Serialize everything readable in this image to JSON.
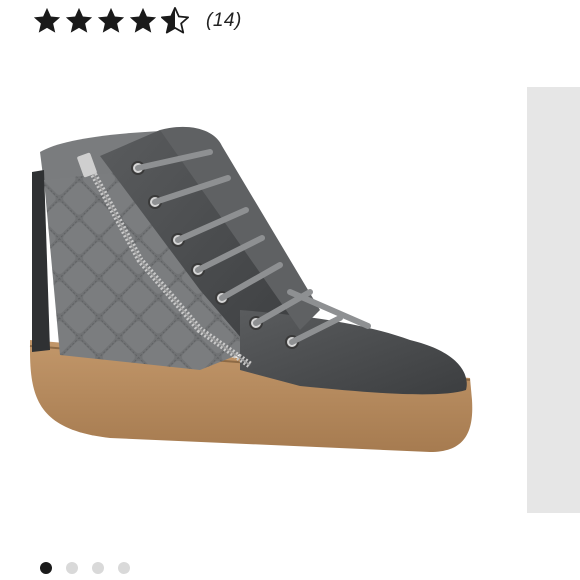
{
  "rating": {
    "value": 4.5,
    "max": 5,
    "review_count": "(14)",
    "star_color": "#1a1a1a"
  },
  "product_image": {
    "icon": "high-top-quilted-sneaker",
    "upper_color": "#6d6f70",
    "leather_color": "#4a4c4e",
    "sole_color": "#b58a5d"
  },
  "carousel": {
    "slide_count": 4,
    "active_index": 0
  }
}
